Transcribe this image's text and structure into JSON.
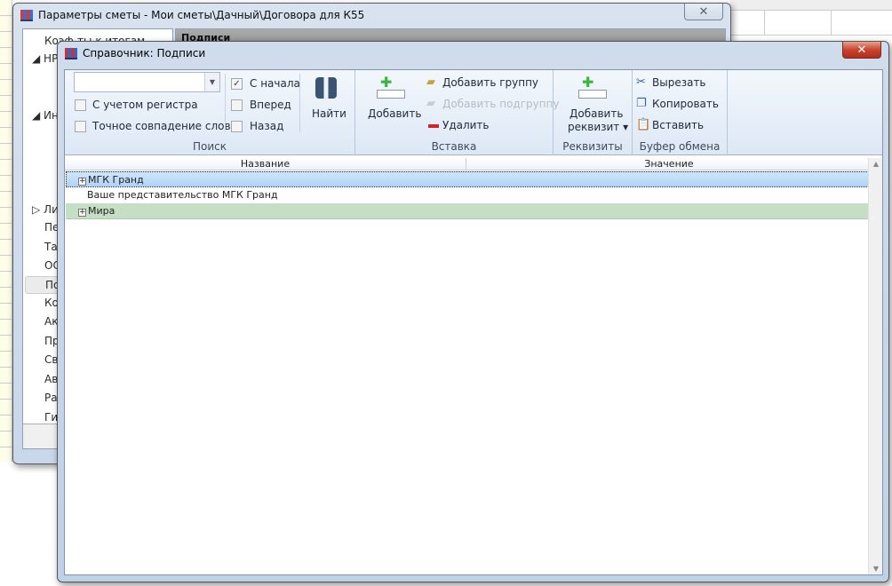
{
  "back_window": {
    "title": "Параметры сметы - Мои сметы\\Дачный\\Договора для К55",
    "close": "✕",
    "tree_items": [
      "Коэф-ты к итогам",
      "НР",
      "Ин",
      "Ли",
      "Пе",
      "Таб",
      "ОС",
      "По",
      "Ко",
      "Ак",
      "Пр",
      "Св",
      "Авт",
      "Рак",
      "Гиг"
    ],
    "panel_header": "Подписи"
  },
  "front_window": {
    "title": "Справочник: Подписи",
    "close": "✕",
    "search": {
      "input_value": "",
      "case_label": "С учетом регистра",
      "exact_label": "Точное совпадение слов",
      "from_start_label": "С начала",
      "from_start_checked": true,
      "forward_label": "Вперед",
      "back_label": "Назад",
      "find_label": "Найти",
      "group_label": "Поиск"
    },
    "insert": {
      "add_label": "Добавить",
      "add_group_label": "Добавить группу",
      "add_subgroup_label": "Добавить подгруппу",
      "delete_label": "Удалить",
      "group_label": "Вставка"
    },
    "requisites": {
      "add_line1": "Добавить",
      "add_line2": "реквизит ▾",
      "group_label": "Реквизиты"
    },
    "clipboard": {
      "cut_label": "Вырезать",
      "copy_label": "Копировать",
      "paste_label": "Вставить",
      "group_label": "Буфер обмена"
    },
    "grid": {
      "columns": [
        "Название",
        "Значение"
      ],
      "rows": [
        {
          "name": "МГК Гранд",
          "value": "",
          "expandable": true,
          "state": "selected"
        },
        {
          "name": "Ваше представительство МГК Гранд",
          "value": "",
          "expandable": false,
          "state": "normal"
        },
        {
          "name": "Мира",
          "value": "",
          "expandable": true,
          "state": "group"
        }
      ]
    }
  }
}
